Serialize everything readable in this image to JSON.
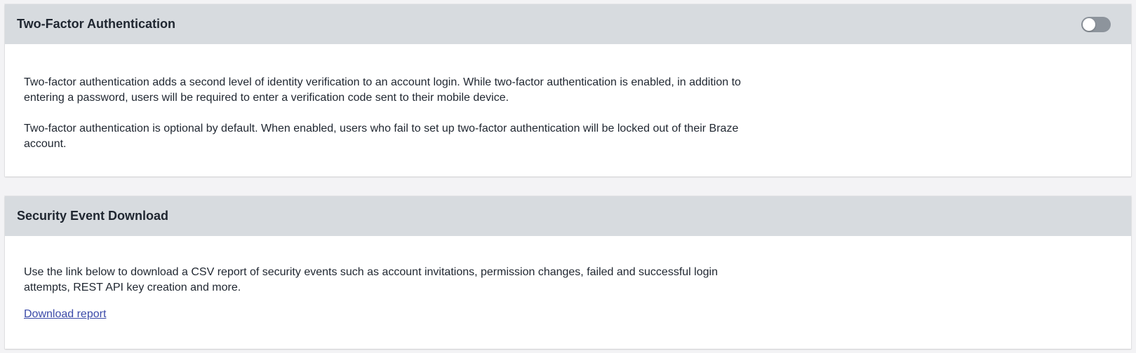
{
  "two_factor": {
    "title": "Two-Factor Authentication",
    "toggle_state": "off",
    "paragraph_1": "Two-factor authentication adds a second level of identity verification to an account login. While two-factor authentication is enabled, in addition to entering a password, users will be required to enter a verification code sent to their mobile device.",
    "paragraph_2": "Two-factor authentication is optional by default. When enabled, users who fail to set up two-factor authentication will be locked out of their Braze account."
  },
  "security_download": {
    "title": "Security Event Download",
    "description": "Use the link below to download a CSV report of security events such as account invitations, permission changes, failed and successful login attempts, REST API key creation and more.",
    "link_label": "Download report"
  },
  "colors": {
    "header_bg": "#d7dbdf",
    "page_bg": "#f3f3f5",
    "link": "#3b4aa8",
    "toggle_off": "#8d949c"
  }
}
